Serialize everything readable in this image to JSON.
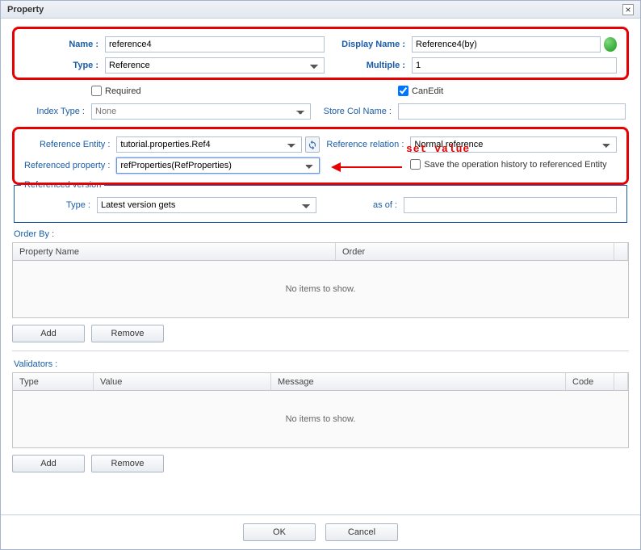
{
  "window": {
    "title": "Property"
  },
  "top": {
    "name_label": "Name :",
    "name_value": "reference4",
    "display_name_label": "Display Name :",
    "display_name_value": "Reference4(by)",
    "type_label": "Type :",
    "type_value": "Reference",
    "multiple_label": "Multiple :",
    "multiple_value": "1"
  },
  "flags": {
    "required_label": "Required",
    "required_checked": false,
    "canedit_label": "CanEdit",
    "canedit_checked": true
  },
  "mid": {
    "index_type_label": "Index Type :",
    "index_type_value": "None",
    "store_col_label": "Store Col Name :",
    "store_col_value": ""
  },
  "ref": {
    "entity_label": "Reference Entity :",
    "entity_value": "tutorial.properties.Ref4",
    "relation_label": "Reference relation :",
    "relation_value": "Normal reference",
    "refprop_label": "Referenced property :",
    "refprop_value": "refProperties(RefProperties)",
    "save_history_label": "Save the operation history to referenced Entity",
    "save_history_checked": false
  },
  "refver": {
    "legend": "Referenced version",
    "type_label": "Type :",
    "type_value": "Latest version gets",
    "asof_label": "as of :",
    "asof_value": ""
  },
  "orderby": {
    "header": "Order By :",
    "col_property": "Property Name",
    "col_order": "Order",
    "empty": "No items to show.",
    "add": "Add",
    "remove": "Remove"
  },
  "validators": {
    "header": "Validators :",
    "col_type": "Type",
    "col_value": "Value",
    "col_message": "Message",
    "col_code": "Code",
    "empty": "No items to show.",
    "add": "Add",
    "remove": "Remove"
  },
  "footer": {
    "ok": "OK",
    "cancel": "Cancel"
  },
  "annotation": {
    "text": "set value"
  }
}
